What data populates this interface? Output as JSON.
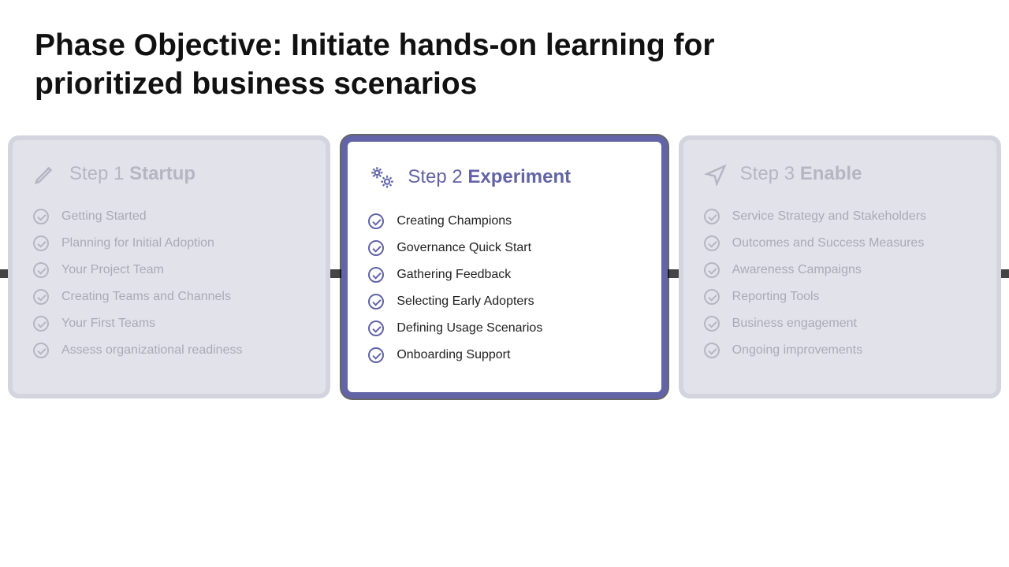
{
  "title": "Phase Objective: Initiate hands-on learning for prioritized business scenarios",
  "steps": [
    {
      "prefix": "Step 1",
      "name": "Startup",
      "icon": "pencil-icon",
      "active": false,
      "items": [
        "Getting Started",
        "Planning for Initial Adoption",
        "Your Project Team",
        "Creating Teams and Channels",
        "Your First Teams",
        "Assess organizational readiness"
      ]
    },
    {
      "prefix": "Step 2",
      "name": "Experiment",
      "icon": "gears-icon",
      "active": true,
      "items": [
        "Creating Champions",
        "Governance Quick Start",
        "Gathering Feedback",
        "Selecting Early Adopters",
        "Defining Usage Scenarios",
        "Onboarding Support"
      ]
    },
    {
      "prefix": "Step 3",
      "name": "Enable",
      "icon": "send-icon",
      "active": false,
      "items": [
        "Service Strategy and Stakeholders",
        "Outcomes and Success Measures",
        "Awareness Campaigns",
        "Reporting Tools",
        "Business engagement",
        "Ongoing improvements"
      ]
    }
  ]
}
